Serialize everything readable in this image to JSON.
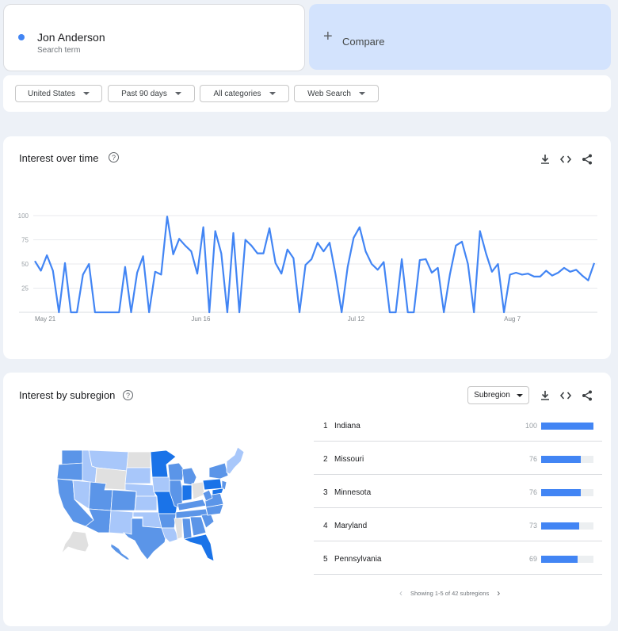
{
  "search_term": {
    "name": "Jon Anderson",
    "sub": "Search term",
    "color": "#4285f4"
  },
  "compare": {
    "icon": "plus-icon",
    "label": "Compare"
  },
  "filters": [
    {
      "label": "United States"
    },
    {
      "label": "Past 90 days"
    },
    {
      "label": "All categories"
    },
    {
      "label": "Web Search"
    }
  ],
  "interest_over_time": {
    "title": "Interest over time",
    "tools": [
      "download-icon",
      "embed-code-icon",
      "share-icon"
    ]
  },
  "chart_data": {
    "type": "line",
    "title": "",
    "xlabel": "",
    "ylabel": "",
    "ylim": [
      0,
      100
    ],
    "yticks": [
      25,
      50,
      75,
      100
    ],
    "x_labels": [
      "May 21",
      "Jun 16",
      "Jul 12",
      "Aug 7"
    ],
    "x_label_index": [
      0,
      26,
      52,
      78
    ],
    "grid": true,
    "series": [
      {
        "color": "#4285f4",
        "values": [
          53,
          43,
          59,
          43,
          0,
          51,
          0,
          0,
          39,
          50,
          0,
          0,
          0,
          0,
          0,
          47,
          0,
          41,
          58,
          0,
          42,
          39,
          99,
          60,
          76,
          69,
          63,
          40,
          88,
          0,
          84,
          61,
          0,
          82,
          0,
          75,
          69,
          61,
          61,
          87,
          51,
          40,
          65,
          56,
          0,
          49,
          55,
          72,
          63,
          72,
          39,
          0,
          47,
          77,
          88,
          63,
          50,
          44,
          52,
          0,
          0,
          55,
          0,
          0,
          54,
          55,
          41,
          46,
          0,
          39,
          69,
          73,
          50,
          0,
          84,
          61,
          42,
          50,
          0,
          39,
          41,
          39,
          40,
          37,
          37,
          43,
          38,
          41,
          46,
          42,
          44,
          38,
          33,
          51
        ]
      }
    ]
  },
  "interest_by_subregion": {
    "title": "Interest by subregion",
    "dropdown": "Subregion",
    "tools": [
      "download-icon",
      "embed-code-icon",
      "share-icon"
    ],
    "ranks": [
      {
        "rank": "1",
        "name": "Indiana",
        "value": "100",
        "level": 100
      },
      {
        "rank": "2",
        "name": "Missouri",
        "value": "76",
        "level": 76
      },
      {
        "rank": "3",
        "name": "Minnesota",
        "value": "76",
        "level": 76
      },
      {
        "rank": "4",
        "name": "Maryland",
        "value": "73",
        "level": 73
      },
      {
        "rank": "5",
        "name": "Pennsylvania",
        "value": "69",
        "level": 69
      }
    ],
    "pager": "Showing 1-5 of 42 subregions",
    "map_colors": {
      "high": "#1a73e8",
      "mid": "#5b95e8",
      "low": "#a8c7fa",
      "none": "#e0e0e0"
    }
  }
}
